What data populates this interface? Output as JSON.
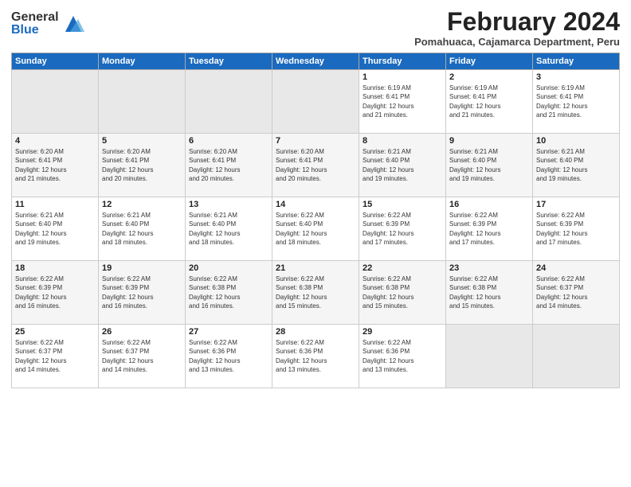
{
  "logo": {
    "general": "General",
    "blue": "Blue"
  },
  "title": {
    "month_year": "February 2024",
    "location": "Pomahuaca, Cajamarca Department, Peru"
  },
  "headers": [
    "Sunday",
    "Monday",
    "Tuesday",
    "Wednesday",
    "Thursday",
    "Friday",
    "Saturday"
  ],
  "weeks": [
    [
      {
        "day": "",
        "info": ""
      },
      {
        "day": "",
        "info": ""
      },
      {
        "day": "",
        "info": ""
      },
      {
        "day": "",
        "info": ""
      },
      {
        "day": "1",
        "info": "Sunrise: 6:19 AM\nSunset: 6:41 PM\nDaylight: 12 hours\nand 21 minutes."
      },
      {
        "day": "2",
        "info": "Sunrise: 6:19 AM\nSunset: 6:41 PM\nDaylight: 12 hours\nand 21 minutes."
      },
      {
        "day": "3",
        "info": "Sunrise: 6:19 AM\nSunset: 6:41 PM\nDaylight: 12 hours\nand 21 minutes."
      }
    ],
    [
      {
        "day": "4",
        "info": "Sunrise: 6:20 AM\nSunset: 6:41 PM\nDaylight: 12 hours\nand 21 minutes."
      },
      {
        "day": "5",
        "info": "Sunrise: 6:20 AM\nSunset: 6:41 PM\nDaylight: 12 hours\nand 20 minutes."
      },
      {
        "day": "6",
        "info": "Sunrise: 6:20 AM\nSunset: 6:41 PM\nDaylight: 12 hours\nand 20 minutes."
      },
      {
        "day": "7",
        "info": "Sunrise: 6:20 AM\nSunset: 6:41 PM\nDaylight: 12 hours\nand 20 minutes."
      },
      {
        "day": "8",
        "info": "Sunrise: 6:21 AM\nSunset: 6:40 PM\nDaylight: 12 hours\nand 19 minutes."
      },
      {
        "day": "9",
        "info": "Sunrise: 6:21 AM\nSunset: 6:40 PM\nDaylight: 12 hours\nand 19 minutes."
      },
      {
        "day": "10",
        "info": "Sunrise: 6:21 AM\nSunset: 6:40 PM\nDaylight: 12 hours\nand 19 minutes."
      }
    ],
    [
      {
        "day": "11",
        "info": "Sunrise: 6:21 AM\nSunset: 6:40 PM\nDaylight: 12 hours\nand 19 minutes."
      },
      {
        "day": "12",
        "info": "Sunrise: 6:21 AM\nSunset: 6:40 PM\nDaylight: 12 hours\nand 18 minutes."
      },
      {
        "day": "13",
        "info": "Sunrise: 6:21 AM\nSunset: 6:40 PM\nDaylight: 12 hours\nand 18 minutes."
      },
      {
        "day": "14",
        "info": "Sunrise: 6:22 AM\nSunset: 6:40 PM\nDaylight: 12 hours\nand 18 minutes."
      },
      {
        "day": "15",
        "info": "Sunrise: 6:22 AM\nSunset: 6:39 PM\nDaylight: 12 hours\nand 17 minutes."
      },
      {
        "day": "16",
        "info": "Sunrise: 6:22 AM\nSunset: 6:39 PM\nDaylight: 12 hours\nand 17 minutes."
      },
      {
        "day": "17",
        "info": "Sunrise: 6:22 AM\nSunset: 6:39 PM\nDaylight: 12 hours\nand 17 minutes."
      }
    ],
    [
      {
        "day": "18",
        "info": "Sunrise: 6:22 AM\nSunset: 6:39 PM\nDaylight: 12 hours\nand 16 minutes."
      },
      {
        "day": "19",
        "info": "Sunrise: 6:22 AM\nSunset: 6:39 PM\nDaylight: 12 hours\nand 16 minutes."
      },
      {
        "day": "20",
        "info": "Sunrise: 6:22 AM\nSunset: 6:38 PM\nDaylight: 12 hours\nand 16 minutes."
      },
      {
        "day": "21",
        "info": "Sunrise: 6:22 AM\nSunset: 6:38 PM\nDaylight: 12 hours\nand 15 minutes."
      },
      {
        "day": "22",
        "info": "Sunrise: 6:22 AM\nSunset: 6:38 PM\nDaylight: 12 hours\nand 15 minutes."
      },
      {
        "day": "23",
        "info": "Sunrise: 6:22 AM\nSunset: 6:38 PM\nDaylight: 12 hours\nand 15 minutes."
      },
      {
        "day": "24",
        "info": "Sunrise: 6:22 AM\nSunset: 6:37 PM\nDaylight: 12 hours\nand 14 minutes."
      }
    ],
    [
      {
        "day": "25",
        "info": "Sunrise: 6:22 AM\nSunset: 6:37 PM\nDaylight: 12 hours\nand 14 minutes."
      },
      {
        "day": "26",
        "info": "Sunrise: 6:22 AM\nSunset: 6:37 PM\nDaylight: 12 hours\nand 14 minutes."
      },
      {
        "day": "27",
        "info": "Sunrise: 6:22 AM\nSunset: 6:36 PM\nDaylight: 12 hours\nand 13 minutes."
      },
      {
        "day": "28",
        "info": "Sunrise: 6:22 AM\nSunset: 6:36 PM\nDaylight: 12 hours\nand 13 minutes."
      },
      {
        "day": "29",
        "info": "Sunrise: 6:22 AM\nSunset: 6:36 PM\nDaylight: 12 hours\nand 13 minutes."
      },
      {
        "day": "",
        "info": ""
      },
      {
        "day": "",
        "info": ""
      }
    ]
  ]
}
